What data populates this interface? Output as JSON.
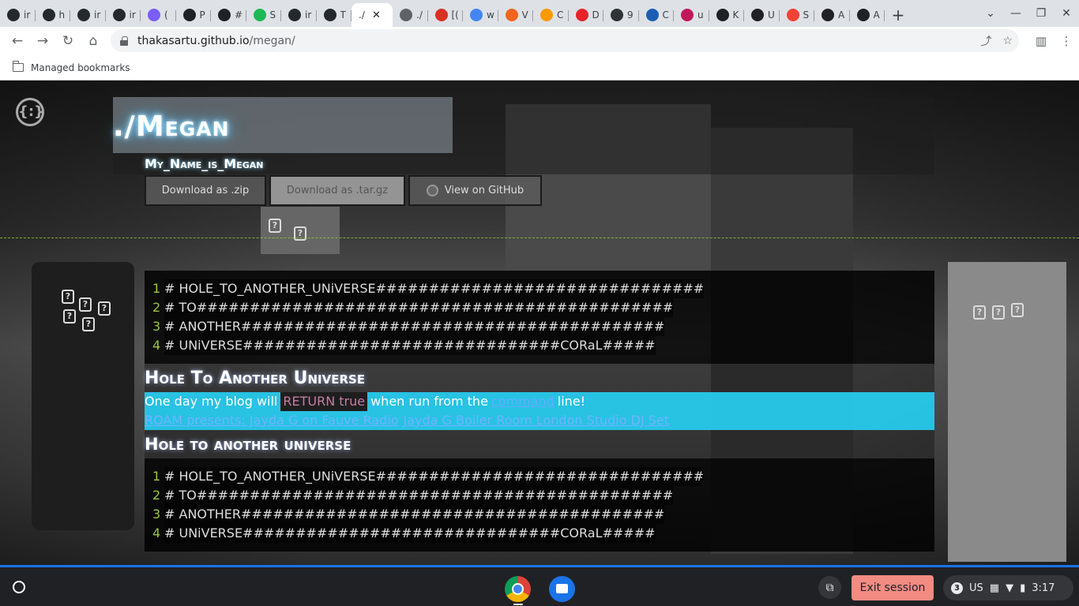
{
  "browser": {
    "tabs": [
      {
        "title": "ir",
        "icon": "github-icon",
        "color": "#24292e"
      },
      {
        "title": "h",
        "icon": "github-icon",
        "color": "#24292e"
      },
      {
        "title": "ir",
        "icon": "github-icon",
        "color": "#24292e"
      },
      {
        "title": "ir",
        "icon": "github-icon",
        "color": "#24292e"
      },
      {
        "title": "(",
        "icon": "kraken-icon",
        "color": "#7b5cff"
      },
      {
        "title": "P",
        "icon": "codepen-icon",
        "color": "#202124"
      },
      {
        "title": "#",
        "icon": "codepen-icon",
        "color": "#202124"
      },
      {
        "title": "S",
        "icon": "spotify-icon",
        "color": "#1db954"
      },
      {
        "title": "ir",
        "icon": "github-icon",
        "color": "#24292e"
      },
      {
        "title": "T",
        "icon": "github-icon",
        "color": "#24292e"
      },
      {
        "title": "./",
        "icon": "",
        "color": "",
        "active": true
      },
      {
        "title": "./",
        "icon": "globe-icon",
        "color": "#5f6368"
      },
      {
        "title": "[(",
        "icon": "gmail-icon",
        "color": "#d93025"
      },
      {
        "title": "w",
        "icon": "google-icon",
        "color": "#4285f4"
      },
      {
        "title": "V",
        "icon": "etsy-icon",
        "color": "#f1641e"
      },
      {
        "title": "C",
        "icon": "amazon-icon",
        "color": "#ff9900"
      },
      {
        "title": "D",
        "icon": "twelve-icon",
        "color": "#e8222a"
      },
      {
        "title": "9",
        "icon": "app-icon",
        "color": "#2e3436"
      },
      {
        "title": "C",
        "icon": "circle-icon",
        "color": "#1a5fb4"
      },
      {
        "title": "u",
        "icon": "app-icon",
        "color": "#c2185b"
      },
      {
        "title": "K",
        "icon": "app-icon",
        "color": "#202124"
      },
      {
        "title": "U",
        "icon": "m-icon",
        "color": "#202124"
      },
      {
        "title": "S",
        "icon": "asterisk-icon",
        "color": "#f44336"
      },
      {
        "title": "A",
        "icon": "codepen-icon",
        "color": "#202124"
      },
      {
        "title": "A",
        "icon": "codepen-icon",
        "color": "#202124"
      }
    ],
    "new_tab": "+",
    "url_host": "thakasartu.github.io",
    "url_path": "/megan/",
    "bookmarks_label": "Managed bookmarks"
  },
  "page": {
    "logo_text": "{:}",
    "project_name": "./Megan",
    "tagline": "My_Name_is_Megan",
    "buttons": {
      "zip": "Download as .zip",
      "tar": "Download as .tar.gz",
      "github": "View on GitHub"
    },
    "code_block": [
      {
        "n": "1",
        "text": "# HOLE_TO_ANOTHER_UNiVERSE###############################"
      },
      {
        "n": "2",
        "text": "# TO#############################################"
      },
      {
        "n": "3",
        "text": "# ANOTHER########################################"
      },
      {
        "n": "4",
        "text": "# UNiVERSE##############################CORaL#####"
      }
    ],
    "heading1": "Hole To Another Universe",
    "blog_pre": "One day my blog will",
    "blog_code": "RETURN true",
    "blog_mid": "when run from the",
    "blog_link": "command",
    "blog_post": "line!",
    "link1": "ROAM presents: Jayda G on Fauve Radio",
    "link2": "Jayda G Boiler Room London Studio DJ Set",
    "heading2": "Hole to another universe"
  },
  "shelf": {
    "exit_label": "Exit session",
    "notification_count": "3",
    "locale": "US",
    "time": "3:17"
  }
}
